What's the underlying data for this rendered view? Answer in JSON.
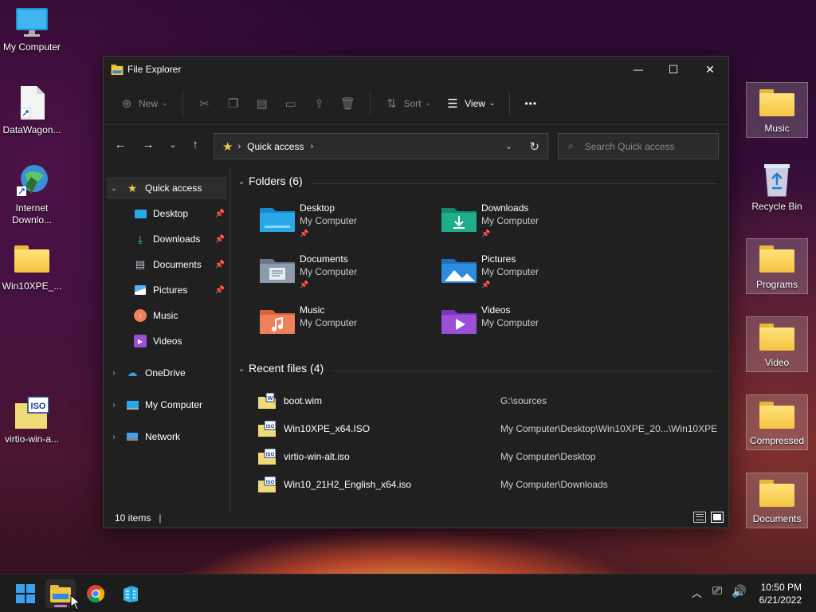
{
  "desktop": {
    "left_icons": [
      {
        "label": "My Computer"
      },
      {
        "label": "DataWagon..."
      },
      {
        "label": "Internet Downlo..."
      },
      {
        "label": "Win10XPE_..."
      },
      {
        "label": "virtio-win-a..."
      }
    ],
    "right_icons": [
      {
        "label": "Music"
      },
      {
        "label": "Recycle Bin"
      },
      {
        "label": "Programs"
      },
      {
        "label": "Video"
      },
      {
        "label": "Compressed"
      },
      {
        "label": "Documents"
      }
    ]
  },
  "window": {
    "title": "File Explorer",
    "controls": {
      "minimize": "—",
      "maximize": "☐",
      "close": "✕"
    }
  },
  "toolbar": {
    "new_label": "New",
    "sort_label": "Sort",
    "view_label": "View",
    "more_label": "•••"
  },
  "address": {
    "path": "Quick access",
    "search_placeholder": "Search Quick access"
  },
  "sidebar": {
    "quick_access": "Quick access",
    "pinned": [
      {
        "label": "Desktop",
        "pinned": true
      },
      {
        "label": "Downloads",
        "pinned": true
      },
      {
        "label": "Documents",
        "pinned": true
      },
      {
        "label": "Pictures",
        "pinned": true
      },
      {
        "label": "Music",
        "pinned": false
      },
      {
        "label": "Videos",
        "pinned": false
      }
    ],
    "onedrive": "OneDrive",
    "my_computer": "My Computer",
    "network": "Network"
  },
  "content": {
    "folders_header": "Folders (6)",
    "folders": [
      {
        "name": "Desktop",
        "location": "My Computer",
        "pinned": true,
        "color": "#2aa7e8"
      },
      {
        "name": "Downloads",
        "location": "My Computer",
        "pinned": true,
        "color": "#1fae8a"
      },
      {
        "name": "Documents",
        "location": "My Computer",
        "pinned": true,
        "color": "#8e9aae"
      },
      {
        "name": "Pictures",
        "location": "My Computer",
        "pinned": true,
        "color": "#2d8be0"
      },
      {
        "name": "Music",
        "location": "My Computer",
        "pinned": false,
        "color": "#f0805a"
      },
      {
        "name": "Videos",
        "location": "My Computer",
        "pinned": false,
        "color": "#9a4fd6"
      }
    ],
    "recent_header": "Recent files (4)",
    "recent": [
      {
        "name": "boot.wim",
        "location": "G:\\sources",
        "badge": "W"
      },
      {
        "name": "Win10XPE_x64.ISO",
        "location": "My Computer\\Desktop\\Win10XPE_20...\\Win10XPE",
        "badge": "ISO"
      },
      {
        "name": "virtio-win-alt.iso",
        "location": "My Computer\\Desktop",
        "badge": "ISO"
      },
      {
        "name": "Win10_21H2_English_x64.iso",
        "location": "My Computer\\Downloads",
        "badge": "ISO"
      }
    ]
  },
  "status": {
    "items": "10 items"
  },
  "taskbar": {
    "time": "10:50 PM",
    "date": "6/21/2022"
  }
}
